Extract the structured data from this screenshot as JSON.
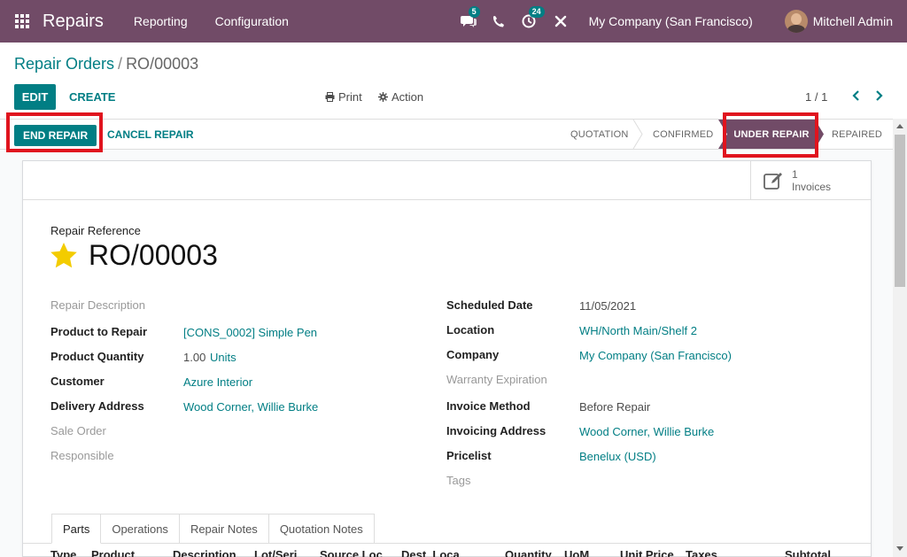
{
  "navbar": {
    "app_title": "Repairs",
    "menu": [
      "Reporting",
      "Configuration"
    ],
    "chat_badge": "5",
    "activity_badge": "24",
    "company": "My Company (San Francisco)",
    "user": "Mitchell Admin",
    "icons": [
      "apps-grid-icon",
      "chat-icon",
      "phone-icon",
      "activity-clock-icon",
      "debug-tools-icon"
    ]
  },
  "breadcrumb": {
    "parent": "Repair Orders",
    "separator": "/",
    "current": "RO/00003"
  },
  "controls": {
    "edit": "EDIT",
    "create": "CREATE",
    "print": "Print",
    "action": "Action",
    "pager": "1 / 1"
  },
  "statusbar": {
    "end_repair": "END REPAIR",
    "cancel_repair": "CANCEL REPAIR",
    "stages": [
      "QUOTATION",
      "CONFIRMED",
      "UNDER REPAIR",
      "REPAIRED"
    ],
    "active_stage": "UNDER REPAIR"
  },
  "smart_button": {
    "count": "1",
    "label": "Invoices"
  },
  "form": {
    "ref_label": "Repair Reference",
    "ref_value": "RO/00003",
    "left_fields": [
      {
        "label": "Repair Description",
        "value": ""
      },
      {
        "label": "Product to Repair",
        "value": "[CONS_0002] Simple Pen"
      },
      {
        "label": "Product Quantity",
        "value": "1.00",
        "unit": "Units"
      },
      {
        "label": "Customer",
        "value": "Azure Interior"
      },
      {
        "label": "Delivery Address",
        "value": "Wood Corner, Willie Burke"
      },
      {
        "label": "Sale Order",
        "value": ""
      },
      {
        "label": "Responsible",
        "value": ""
      }
    ],
    "right_fields": [
      {
        "label": "Scheduled Date",
        "value": "11/05/2021"
      },
      {
        "label": "Location",
        "value": "WH/North Main/Shelf 2"
      },
      {
        "label": "Company",
        "value": "My Company (San Francisco)"
      },
      {
        "label": "Warranty Expiration",
        "value": ""
      },
      {
        "label": "Invoice Method",
        "value": "Before Repair"
      },
      {
        "label": "Invoicing Address",
        "value": "Wood Corner, Willie Burke"
      },
      {
        "label": "Pricelist",
        "value": "Benelux (USD)"
      },
      {
        "label": "Tags",
        "value": ""
      }
    ]
  },
  "tabs": [
    "Parts",
    "Operations",
    "Repair Notes",
    "Quotation Notes"
  ],
  "table": {
    "headers": [
      "Type",
      "Product",
      "Description",
      "Lot/Seri",
      "Source Loc",
      "Dest. Loca",
      "Quantity",
      "UoM",
      "Unit Price",
      "Taxes",
      "Subtotal"
    ]
  },
  "colors": {
    "brand": "#714b67",
    "primary": "#017e84",
    "highlight": "#e0141e",
    "star": "#f3cc00"
  }
}
